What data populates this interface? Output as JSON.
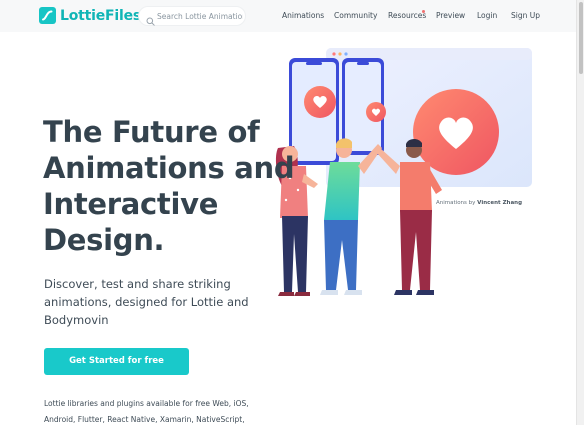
{
  "brand": {
    "name": "LottieFiles",
    "color": "#17c5c5"
  },
  "search": {
    "placeholder": "Search Lottie Animations"
  },
  "nav": {
    "animations": "Animations",
    "community": "Community",
    "resources": "Resources",
    "preview": "Preview",
    "login": "Login",
    "signup": "Sign Up"
  },
  "hero": {
    "title": "The Future of Animations and Interactive Design.",
    "subtitle": "Discover, test and share striking animations, designed for Lottie and Bodymovin",
    "cta_label": "Get Started for free",
    "libraries_text": "Lottie libraries and plugins available for free Web, iOS, Android, Flutter, React Native, Xamarin, NativeScript,"
  },
  "credit": {
    "prefix": "Animations by",
    "author": "Vincent Zhang"
  },
  "colors": {
    "accent": "#19c9ca",
    "heart": "#f5675f",
    "heading": "#34434e"
  },
  "icons": [
    "lottiefiles-logo-icon",
    "search-icon",
    "heart-icon"
  ]
}
